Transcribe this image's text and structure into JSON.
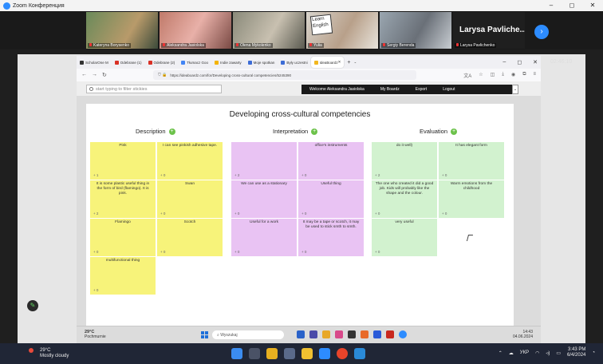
{
  "zoom": {
    "title": "Zoom Конференция",
    "window_controls": [
      "–",
      "◻",
      "✕"
    ]
  },
  "participants": [
    {
      "name": "Kateryna Borysenko"
    },
    {
      "name": "Aleksandra Jasiolska"
    },
    {
      "name": "Olena Mykolenko"
    },
    {
      "name": "Yulia",
      "card_text": "Learn English"
    },
    {
      "name": "Sergiy Berenda"
    },
    {
      "name": "Larysa Pavlichenko",
      "display_name": "Larysa Pavliche..."
    }
  ],
  "timer": "02:46:10",
  "browser": {
    "tabs": [
      {
        "label": "ScholarOne M",
        "color": "#333333"
      },
      {
        "label": "Odebrane (1)",
        "color": "#d93025"
      },
      {
        "label": "Odebrane (2)",
        "color": "#d93025"
      },
      {
        "label": "Tłumacz Goo",
        "color": "#4285f4"
      },
      {
        "label": "Indie zawarty",
        "color": "#f4b400"
      },
      {
        "label": "Moje spotkan",
        "color": "#3c6cd6"
      },
      {
        "label": "Były uczestni",
        "color": "#3c6cd6"
      },
      {
        "label": "IdeaBoardz",
        "color": "#f2b71f",
        "active": true
      }
    ],
    "url": "https://ideaboardz.com/for/Developing cross-cultural competencies/5245390"
  },
  "app": {
    "filter_placeholder": "start typing to filter stickies",
    "welcome": "Welcome Aleksandra Jasiolska",
    "my_boards": "My Boardz",
    "export": "Export",
    "logout": "Logout"
  },
  "board": {
    "title": "Developing cross-cultural competencies",
    "columns": [
      {
        "name": "Description",
        "color": "#f7f37a",
        "stickies": [
          {
            "text": "Pink",
            "votes": "+ 1"
          },
          {
            "text": "I can see pinkish adhesive tape.",
            "votes": "+ 0"
          },
          {
            "text": "It is some plastic useful thing in the form of bird (flamingo). It is pink.",
            "votes": "+ 2"
          },
          {
            "text": "Swan",
            "votes": "+ 0"
          },
          {
            "text": "Flamingo",
            "votes": "+ 0"
          },
          {
            "text": "Scotch",
            "votes": "+ 0"
          },
          {
            "text": "multifunctional thing",
            "votes": "+ 0"
          }
        ]
      },
      {
        "name": "Interpretation",
        "color": "#e9c3f3",
        "stickies": [
          {
            "text": "",
            "votes": "+ 2"
          },
          {
            "text": "office's instruments",
            "votes": "+ 0"
          },
          {
            "text": "We can use as a stationary",
            "votes": "+ 0"
          },
          {
            "text": "Useful thing",
            "votes": "+ 0"
          },
          {
            "text": "Useful for a work",
            "votes": "+ 0"
          },
          {
            "text": "It may be a tape or scotch, it may be used to stick smth to smth.",
            "votes": "+ 0"
          }
        ]
      },
      {
        "name": "Evaluation",
        "color": "#d2f2cf",
        "stickies": [
          {
            "text": "do it well)",
            "votes": "+ 2"
          },
          {
            "text": "It has elegant form",
            "votes": "+ 0"
          },
          {
            "text": "The one who created it did a good job. Kids will probably like the shape and the colour.",
            "votes": "+ 0"
          },
          {
            "text": "Warm emotions from the childhood",
            "votes": "+ 0"
          },
          {
            "text": "very useful",
            "votes": "+ 0"
          }
        ]
      }
    ]
  },
  "inner_taskbar": {
    "weather_temp": "29°C",
    "weather_desc": "Pochmurnie",
    "search_placeholder": "Wyszukaj",
    "time": "14:43",
    "date": "04.06.2024"
  },
  "taskbar": {
    "weather_temp": "29°C",
    "weather_desc": "Mostly cloudy",
    "lang": "УКР",
    "time": "3:43 PM",
    "date": "6/4/2024"
  }
}
